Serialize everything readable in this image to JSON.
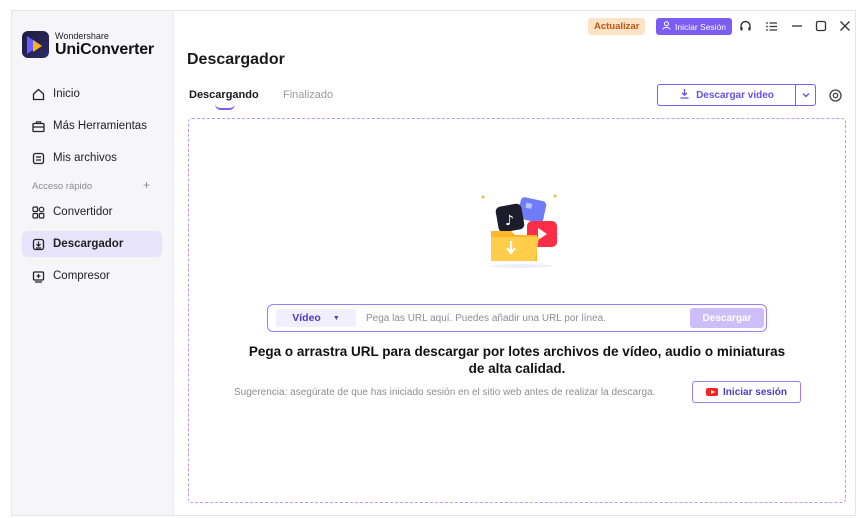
{
  "app": {
    "brand_small": "Wondershare",
    "brand_big": "UniConverter"
  },
  "topbar": {
    "update_label": "Actualizar",
    "login_label": "Iniciar Sesión",
    "icons": [
      "headset-icon",
      "menu-icon",
      "minimize-icon",
      "maximize-icon",
      "close-icon"
    ]
  },
  "sidebar": {
    "items": [
      {
        "label": "Inicio",
        "icon": "home-icon"
      },
      {
        "label": "Más Herramientas",
        "icon": "toolbox-icon"
      },
      {
        "label": "Mis archivos",
        "icon": "files-icon"
      }
    ],
    "section_label": "Acceso rápido",
    "quick": [
      {
        "label": "Convertidor",
        "icon": "converter-icon"
      },
      {
        "label": "Descargador",
        "icon": "downloader-icon",
        "active": true
      },
      {
        "label": "Compresor",
        "icon": "compressor-icon"
      }
    ]
  },
  "main": {
    "title": "Descargador",
    "tabs": [
      {
        "label": "Descargando",
        "active": true
      },
      {
        "label": "Finalizado",
        "active": false
      }
    ],
    "download_video_label": "Descargar video",
    "url_bar": {
      "type_value": "Vídeo",
      "placeholder": "Pega las URL aquí. Puedes añadir una URL por línea.",
      "download_label": "Descargar"
    },
    "headline_line1": "Pega o arrastra URL para descargar por lotes archivos de vídeo, audio o miniaturas",
    "headline_line2": "de alta calidad.",
    "hint": "Sugerencia: asegúrate de que has iniciado sesión en el sitio web antes de realizar la descarga.",
    "login_button_label": "Iniciar sesión"
  },
  "colors": {
    "accent": "#7b5cf5",
    "update_bg": "#fde3c6",
    "update_text": "#c4540e",
    "youtube_red": "#ff1f1f"
  }
}
